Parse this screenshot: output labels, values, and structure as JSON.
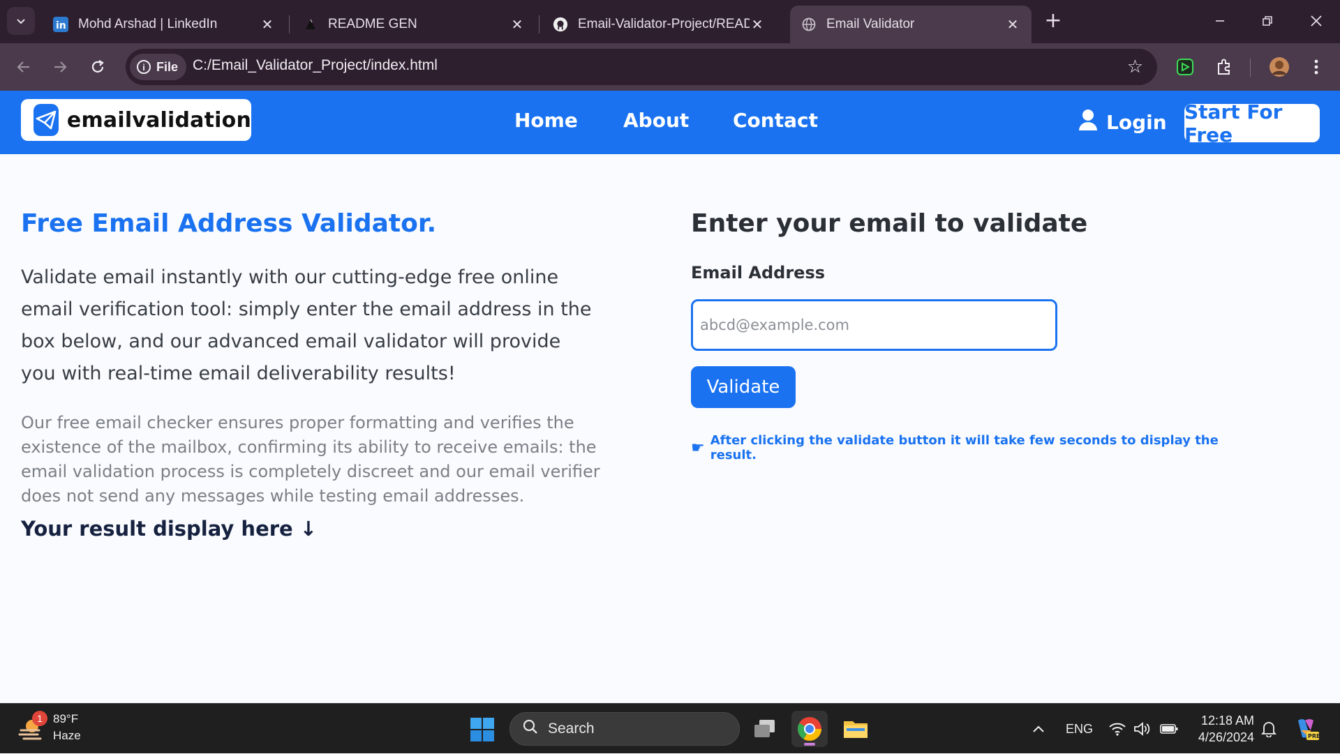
{
  "browser": {
    "tabs": [
      {
        "title": "Mohd Arshad | LinkedIn",
        "icon": "linkedin-icon"
      },
      {
        "title": "README GEN",
        "icon": "triangle-icon"
      },
      {
        "title": "Email-Validator-Project/READM",
        "icon": "github-icon"
      },
      {
        "title": "Email Validator",
        "icon": "globe-icon",
        "active": true
      }
    ],
    "chip_label": "File",
    "url": "C:/Email_Validator_Project/index.html"
  },
  "site": {
    "logo_text": "emailvalidation",
    "nav": [
      "Home",
      "About",
      "Contact"
    ],
    "login_label": "Login",
    "cta_label": "Start For Free",
    "accent_color": "#1a72f0"
  },
  "hero": {
    "title": "Free Email Address Validator.",
    "lead": "Validate email instantly with our cutting-edge free online email verification tool: simply enter the email address in the box below, and our advanced email validator will provide you with real-time email deliverability results!",
    "sub": "Our free email checker ensures proper formatting and verifies the existence of the mailbox, confirming its ability to receive emails: the email validation process is completely discreet and our email verifier does not send any messages while testing email addresses.",
    "result_label": "Your result display here ↓"
  },
  "form": {
    "title": "Enter your email to validate",
    "field_label": "Email Address",
    "placeholder": "abcd@example.com",
    "value": "",
    "button_label": "Validate",
    "hint_icon": "☛",
    "hint": "After clicking the validate button it will take few seconds to display the result."
  },
  "taskbar": {
    "weather_badge": "1",
    "temperature": "89°F",
    "condition": "Haze",
    "search_label": "Search",
    "language": "ENG",
    "time": "12:18 AM",
    "date": "4/26/2024"
  }
}
